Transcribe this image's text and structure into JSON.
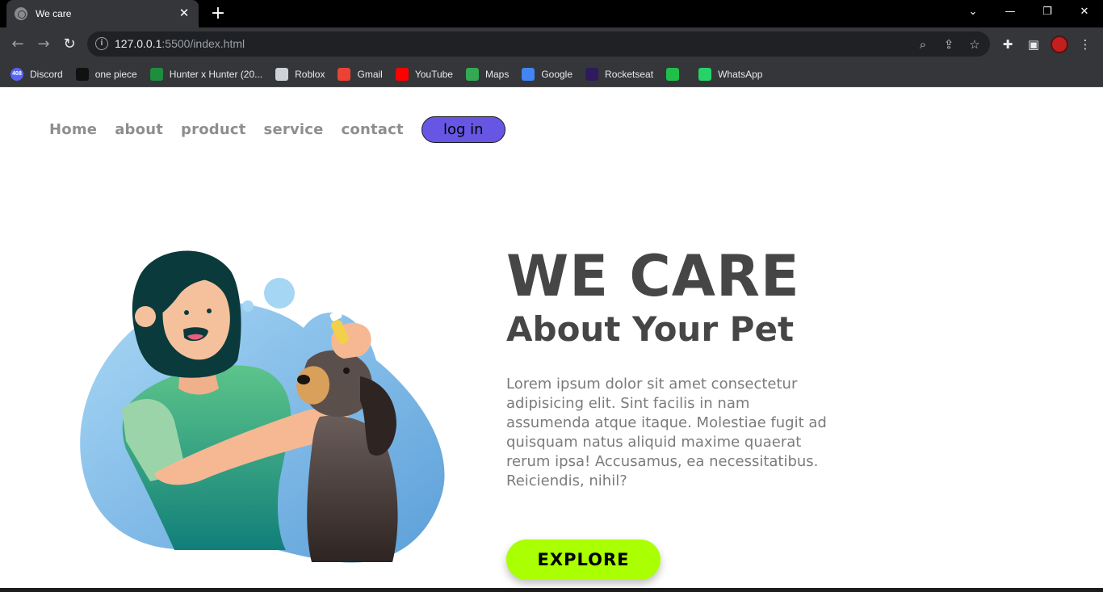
{
  "browser": {
    "tab_title": "We care",
    "url_host": "127.0.0.1",
    "url_path": ":5500/index.html",
    "bookmarks": [
      {
        "label": "Discord",
        "icon": "discord-icon",
        "color": "#5865f2",
        "badge": "408"
      },
      {
        "label": "one piece",
        "icon": "one-piece-icon",
        "color": "#111111"
      },
      {
        "label": "Hunter x Hunter (20...",
        "icon": "hunter-icon",
        "color": "#1e8e3e"
      },
      {
        "label": "Roblox",
        "icon": "roblox-icon",
        "color": "#cfd3d8"
      },
      {
        "label": "Gmail",
        "icon": "gmail-icon",
        "color": "#ea4335"
      },
      {
        "label": "YouTube",
        "icon": "youtube-icon",
        "color": "#ff0000"
      },
      {
        "label": "Maps",
        "icon": "maps-icon",
        "color": "#34a853"
      },
      {
        "label": "Google",
        "icon": "google-icon",
        "color": "#4285f4"
      },
      {
        "label": "Rocketseat",
        "icon": "rocketseat-icon",
        "color": "#2d1b5e"
      },
      {
        "label": "",
        "icon": "phone-icon",
        "color": "#1fbf4a"
      },
      {
        "label": "WhatsApp",
        "icon": "whatsapp-icon",
        "color": "#25d366"
      }
    ]
  },
  "nav": {
    "home": "Home",
    "about": "about",
    "product": "product",
    "service": "service",
    "contact": "contact",
    "login": "log in"
  },
  "hero": {
    "headline": "WE CARE",
    "subhead": "About Your Pet",
    "description": "Lorem ipsum dolor sit amet consectetur adipisicing elit. Sint facilis in nam assumenda atque itaque. Molestiae fugit ad quisquam natus aliquid maxime quaerat rerum ipsa! Accusamus, ea necessitatibus. Reiciendis, nihil?",
    "cta": "EXPLORE"
  },
  "colors": {
    "login_bg": "#6656e3",
    "cta_bg": "#aaff00",
    "text_dark": "#464646",
    "text_muted": "#7b7b7b",
    "nav_text": "#8e8e8e"
  }
}
